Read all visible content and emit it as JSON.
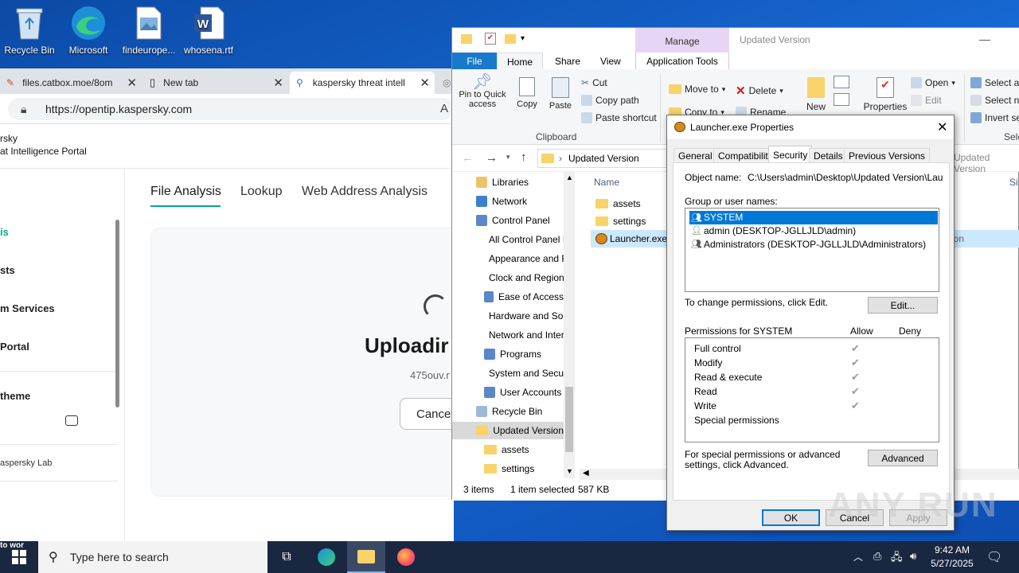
{
  "desktop": {
    "icons": [
      {
        "label": "Recycle Bin"
      },
      {
        "label": "Microsoft Edge"
      },
      {
        "label": "findeurope..."
      },
      {
        "label": "whosena.rtf"
      }
    ]
  },
  "browser": {
    "tabs": [
      {
        "label": "files.catbox.moe/8om"
      },
      {
        "label": "New tab"
      },
      {
        "label": "kaspersky threat intelli"
      }
    ],
    "url": "https://opentip.kaspersky.com",
    "site": {
      "brand_line1": "rsky",
      "brand_line2": "at Intelligence Portal",
      "nav": [
        {
          "label": "is"
        },
        {
          "label": "sts"
        },
        {
          "label": "m Services"
        },
        {
          "label": "Portal"
        }
      ],
      "theme_label": "theme",
      "footer_label": "aspersky Lab",
      "tabs": [
        {
          "label": "File Analysis"
        },
        {
          "label": "Lookup"
        },
        {
          "label": "Web Address Analysis"
        }
      ],
      "upload_title": "Uploadir",
      "upload_file": "475ouv.r",
      "cancel_label": "Cance"
    }
  },
  "explorer": {
    "manage_label": "Manage",
    "window_title": "Updated Version",
    "ribbon_tabs": [
      "File",
      "Home",
      "Share",
      "View",
      "Application Tools"
    ],
    "clipboard": {
      "pin_label": "Pin to Quick access",
      "copy_label": "Copy",
      "paste_label": "Paste",
      "cut_label": "Cut",
      "copy_path_label": "Copy path",
      "paste_shortcut_label": "Paste shortcut",
      "group_label": "Clipboard"
    },
    "organize": {
      "move_to": "Move to",
      "delete": "Delete",
      "copy_to": "Copy to",
      "rename": "Rename",
      "new": "New"
    },
    "open_group": {
      "properties": "Properties",
      "open": "Open",
      "edit": "Edit"
    },
    "select_group": {
      "select_all": "Select all",
      "select_none": "Select none",
      "invert": "Invert selection",
      "label": "Select"
    },
    "breadcrumb": "Updated Version",
    "search_hint": "Updated Version",
    "col_name": "Name",
    "col_size": "Si",
    "tree": [
      {
        "label": "Libraries"
      },
      {
        "label": "Network"
      },
      {
        "label": "Control Panel"
      },
      {
        "label": "All Control Panel Items"
      },
      {
        "label": "Appearance and Personalization"
      },
      {
        "label": "Clock and Region"
      },
      {
        "label": "Ease of Access"
      },
      {
        "label": "Hardware and Sound"
      },
      {
        "label": "Network and Internet"
      },
      {
        "label": "Programs"
      },
      {
        "label": "System and Security"
      },
      {
        "label": "User Accounts"
      },
      {
        "label": "Recycle Bin"
      },
      {
        "label": "Updated Version"
      },
      {
        "label": "assets"
      },
      {
        "label": "settings"
      }
    ],
    "files": [
      {
        "name": "assets"
      },
      {
        "name": "settings"
      },
      {
        "name": "Launcher.exe"
      }
    ],
    "status": {
      "count": "3 items",
      "selected": "1 item selected",
      "size": "587 KB"
    },
    "partial_app": "ion"
  },
  "dialog": {
    "title": "Launcher.exe Properties",
    "tabs": [
      "General",
      "Compatibility",
      "Security",
      "Details",
      "Previous Versions"
    ],
    "object_name_label": "Object name:",
    "object_name_value": "C:\\Users\\admin\\Desktop\\Updated Version\\Launc",
    "group_label": "Group or user names:",
    "users": [
      {
        "name": "SYSTEM"
      },
      {
        "name": "admin (DESKTOP-JGLLJLD\\admin)"
      },
      {
        "name": "Administrators (DESKTOP-JGLLJLD\\Administrators)"
      }
    ],
    "change_text": "To change permissions, click Edit.",
    "edit_button": "Edit...",
    "perm_header": "Permissions for SYSTEM",
    "allow_label": "Allow",
    "deny_label": "Deny",
    "permissions": [
      {
        "name": "Full control",
        "allow": "✔"
      },
      {
        "name": "Modify",
        "allow": "✔"
      },
      {
        "name": "Read & execute",
        "allow": "✔"
      },
      {
        "name": "Read",
        "allow": "✔"
      },
      {
        "name": "Write",
        "allow": "✔"
      },
      {
        "name": "Special permissions",
        "allow": ""
      }
    ],
    "special_text": "For special permissions or advanced settings, click Advanced.",
    "advanced_button": "Advanced",
    "ok_button": "OK",
    "cancel_button": "Cancel",
    "apply_button": "Apply"
  },
  "taskbar": {
    "search_placeholder": "Type here to search",
    "time": "9:42 AM",
    "date": "5/27/2025",
    "left_fragment": "to wor"
  },
  "watermark": "ANY RUN"
}
